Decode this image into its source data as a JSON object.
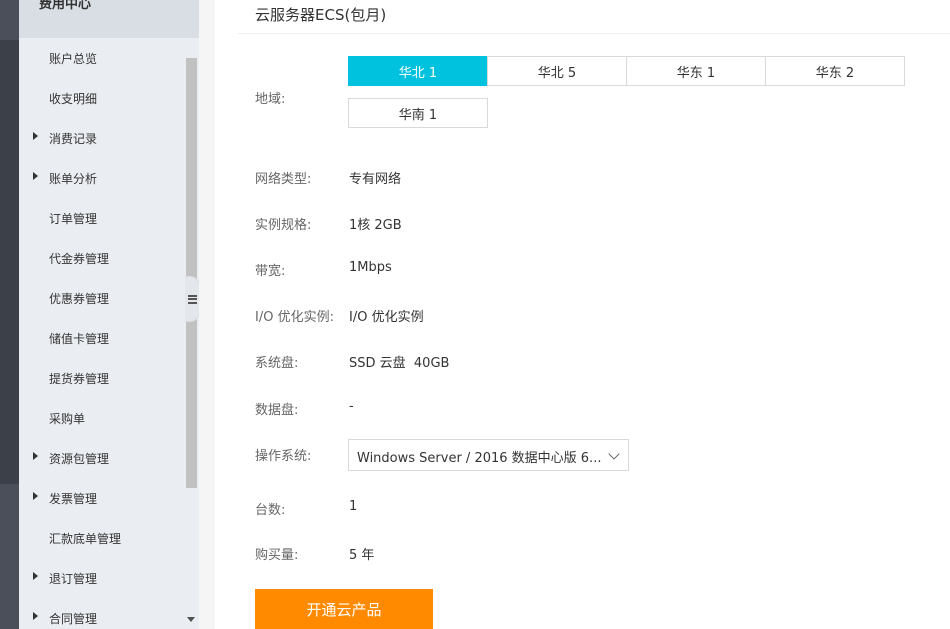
{
  "sidebar": {
    "header": "费用中心",
    "items": [
      {
        "label": "账户总览",
        "expandable": false
      },
      {
        "label": "收支明细",
        "expandable": false
      },
      {
        "label": "消费记录",
        "expandable": true
      },
      {
        "label": "账单分析",
        "expandable": true
      },
      {
        "label": "订单管理",
        "expandable": false
      },
      {
        "label": "代金券管理",
        "expandable": false
      },
      {
        "label": "优惠券管理",
        "expandable": false
      },
      {
        "label": "储值卡管理",
        "expandable": false
      },
      {
        "label": "提货券管理",
        "expandable": false
      },
      {
        "label": "采购单",
        "expandable": false
      },
      {
        "label": "资源包管理",
        "expandable": true
      },
      {
        "label": "发票管理",
        "expandable": true
      },
      {
        "label": "汇款底单管理",
        "expandable": false
      },
      {
        "label": "退订管理",
        "expandable": true
      },
      {
        "label": "合同管理",
        "expandable": true
      }
    ]
  },
  "main": {
    "title": "云服务器ECS(包月)",
    "region": {
      "label": "地域:",
      "options": [
        "华北 1",
        "华北 5",
        "华东 1",
        "华东 2",
        "华南 1"
      ],
      "selected": "华北 1"
    },
    "network": {
      "label": "网络类型:",
      "value": "专有网络"
    },
    "instance": {
      "label": "实例规格:",
      "value": "1核 2GB"
    },
    "bandwidth": {
      "label": "带宽:",
      "value": "1Mbps"
    },
    "io": {
      "label": "I/O 优化实例:",
      "value": "I/O 优化实例"
    },
    "system_disk": {
      "label": "系统盘:",
      "value": "SSD 云盘  40GB"
    },
    "data_disk": {
      "label": "数据盘:",
      "value": "-"
    },
    "os": {
      "label": "操作系统:",
      "value": "Windows Server / 2016 数据中心版 6..."
    },
    "count": {
      "label": "台数:",
      "value": "1"
    },
    "duration": {
      "label": "购买量:",
      "value": "5 年"
    },
    "buy_button": "开通云产品"
  },
  "colors": {
    "accent": "#00c1de",
    "cta": "#ff8a00",
    "sidebar_bg": "#eaedf1",
    "rail_bg": "#3c4049"
  }
}
